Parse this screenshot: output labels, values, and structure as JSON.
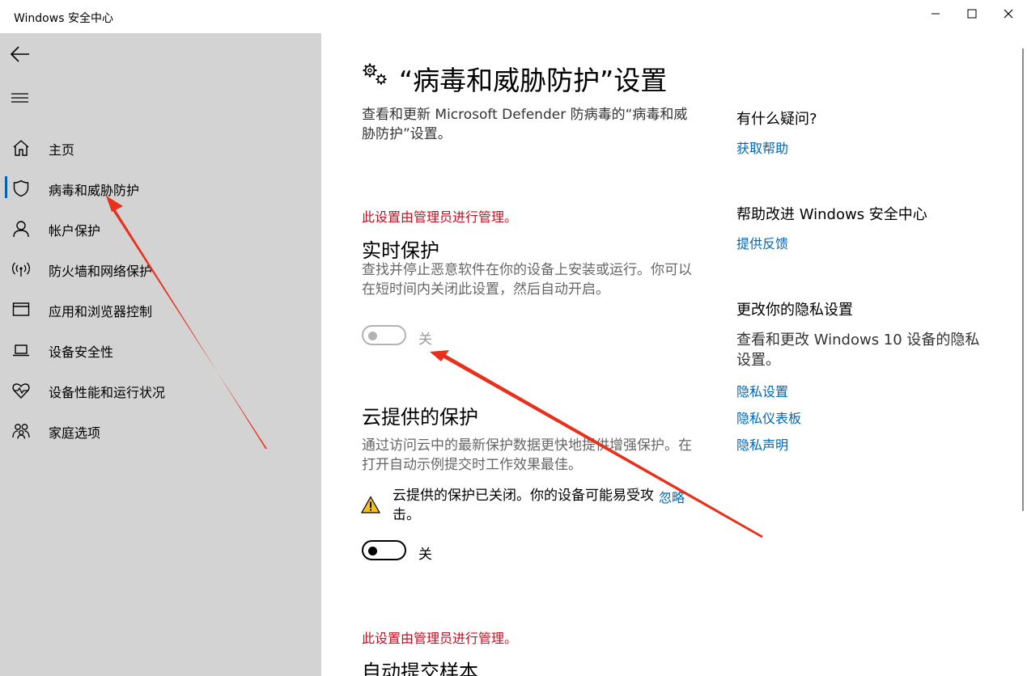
{
  "window": {
    "title": "Windows 安全中心",
    "controls": [
      "minimize-icon",
      "maximize-icon",
      "close-icon"
    ]
  },
  "sidebar": {
    "back_icon": "back-arrow-icon",
    "menu_icon": "hamburger-icon",
    "selected_index": 1,
    "items": [
      {
        "label": "主页",
        "icon": "home-icon"
      },
      {
        "label": "病毒和威胁防护",
        "icon": "shield-icon"
      },
      {
        "label": "帐户保护",
        "icon": "person-icon"
      },
      {
        "label": "防火墙和网络保护",
        "icon": "wifi-signal-icon"
      },
      {
        "label": "应用和浏览器控制",
        "icon": "browser-window-icon"
      },
      {
        "label": "设备安全性",
        "icon": "laptop-icon"
      },
      {
        "label": "设备性能和运行状况",
        "icon": "heart-pulse-icon"
      },
      {
        "label": "家庭选项",
        "icon": "family-icon"
      }
    ]
  },
  "main": {
    "title": "“病毒和威胁防护”设置",
    "title_icon": "gears-icon",
    "description": "查看和更新 Microsoft Defender 防病毒的“病毒和威胁防护”设置。",
    "sections": [
      {
        "admin_note": "此设置由管理员进行管理。",
        "title": "实时保护",
        "description": "查找并停止恶意软件在你的设备上安装或运行。你可以在短时间内关闭此设置，然后自动开启。",
        "toggle_label": "关",
        "toggle_on": false,
        "enabled": false
      },
      {
        "title": "云提供的保护",
        "description": "通过访问云中的最新保护数据更快地提供增强保护。在打开自动示例提交时工作效果最佳。",
        "warning": "云提供的保护已关闭。你的设备可能易受攻击。",
        "warning_icon": "warning-triangle-icon",
        "dismiss_label": "忽略",
        "toggle_label": "关",
        "toggle_on": false,
        "enabled": true
      },
      {
        "admin_note": "此设置由管理员进行管理。",
        "title": "自动提交样本"
      }
    ]
  },
  "aside": {
    "question_title": "有什么疑问?",
    "help_link": "获取帮助",
    "improve_title": "帮助改进 Windows 安全中心",
    "feedback_link": "提供反馈",
    "privacy_title": "更改你的隐私设置",
    "privacy_text": "查看和更改 Windows 10 设备的隐私设置。",
    "privacy_links": [
      "隐私设置",
      "隐私仪表板",
      "隐私声明"
    ]
  },
  "colors": {
    "sidebar_bg": "#d3d3d3",
    "accent": "#0063b1",
    "link": "#0067b8",
    "admin_note": "#c50f1f",
    "annotation_arrow": "#e8311d"
  }
}
